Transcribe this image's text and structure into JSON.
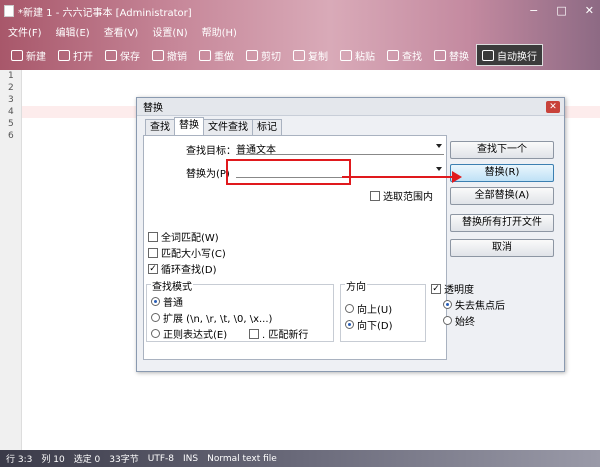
{
  "window": {
    "title": "*新建 1 - 六六记事本 [Administrator]"
  },
  "menu": [
    "文件(F)",
    "编辑(E)",
    "查看(V)",
    "设置(N)",
    "帮助(H)"
  ],
  "toolbar": [
    "新建",
    "打开",
    "保存",
    "撤销",
    "重做",
    "剪切",
    "复制",
    "粘贴",
    "查找",
    "替换",
    "自动换行"
  ],
  "editor": {
    "line_numbers": [
      "1",
      "2",
      "3",
      "4",
      "5",
      "6"
    ]
  },
  "dialog": {
    "title": "替换",
    "tabs": [
      "查找",
      "替换",
      "文件查找",
      "标记"
    ],
    "find_label": "查找目标：",
    "find_value": "普通文本",
    "replace_label": "替换为(P)",
    "replace_value": "",
    "in_selection": "选取范围内",
    "buttons": {
      "find_next": "查找下一个",
      "replace": "替换(R)",
      "replace_all": "全部替换(A)",
      "replace_all_open": "替换所有打开文件",
      "cancel": "取消"
    },
    "options": {
      "whole_word": "全词匹配(W)",
      "match_case": "匹配大小写(C)",
      "wrap": "循环查找(D)"
    },
    "search_mode": {
      "title": "查找模式",
      "normal": "普通",
      "extended": "扩展 (\\n, \\r, \\t, \\0, \\x...)",
      "regex": "正则表达式(E)",
      "dot_newline": ". 匹配新行"
    },
    "direction": {
      "title": "方向",
      "up": "向上(U)",
      "down": "向下(D)"
    },
    "transparency": {
      "title": "透明度",
      "on_lose_focus": "失去焦点后",
      "always": "始终"
    }
  },
  "status": [
    "行 3:3",
    "列 10",
    "选定 0",
    "33字节",
    "UTF-8",
    "INS",
    "Normal text file"
  ],
  "colors": {
    "annotation": "#e0191d"
  }
}
